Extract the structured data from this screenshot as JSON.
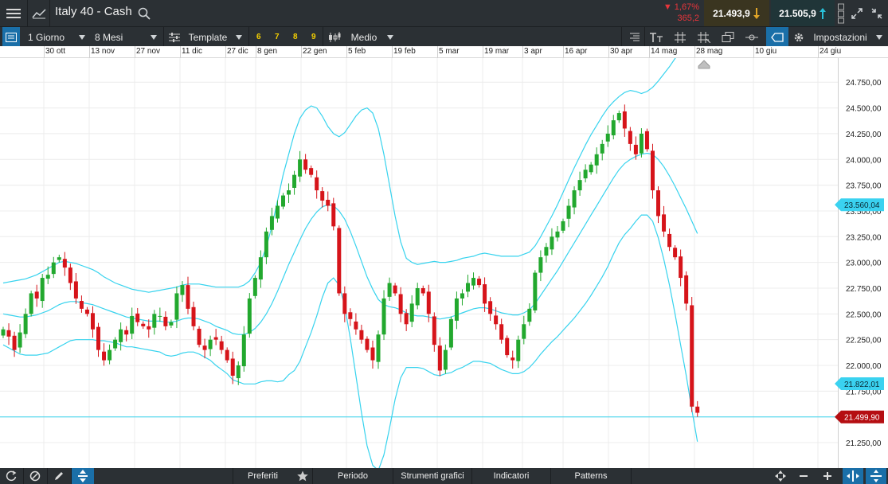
{
  "topbar": {
    "title": "Italy 40 - Cash",
    "change_pct": "▼ 1,67%",
    "change_pts": "365,2",
    "bid": "21.493,9",
    "ask": "21.505,9",
    "menu_icon": "menu-icon",
    "chart_icon": "chart-line-icon",
    "search_icon": "search-icon"
  },
  "toolbar": {
    "interval": "1 Giorno",
    "period": "8 Mesi",
    "template": "Template",
    "numbers": [
      "6",
      "7",
      "8",
      "9"
    ],
    "candle_type": "Medio",
    "settings": "Impostazioni"
  },
  "bottombar": {
    "favorites": "Preferiti",
    "period": "Periodo",
    "drawing_tools": "Strumenti grafici",
    "indicators": "Indicatori",
    "patterns": "Patterns"
  },
  "colors": {
    "up": "#22a82e",
    "down": "#d6141a",
    "bands": "#37d3ee",
    "price_tag": "#b50e12",
    "band_tag": "#3ad2f0"
  },
  "chart_data": {
    "type": "candlestick",
    "x_ticks": [
      "30 ott",
      "13 nov",
      "27 nov",
      "11 dic",
      "27 dic",
      "8 gen",
      "22 gen",
      "5 feb",
      "19 feb",
      "5 mar",
      "19 mar",
      "3 apr",
      "16 apr",
      "30 apr",
      "14 mag",
      "28 mag",
      "10 giu",
      "24 giu"
    ],
    "y_ticks": [
      "24.750,00",
      "24.500,00",
      "24.250,00",
      "24.000,00",
      "23.750,00",
      "23.500,00",
      "23.250,00",
      "23.000,00",
      "22.750,00",
      "22.500,00",
      "22.250,00",
      "22.000,00",
      "21.750,00",
      "21.500,00",
      "21.250,00"
    ],
    "y_tick_values": [
      24750,
      24500,
      24250,
      24000,
      23750,
      23500,
      23250,
      23000,
      22750,
      22500,
      22250,
      22000,
      21750,
      21500,
      21250
    ],
    "ylim": [
      21150,
      24860
    ],
    "indicator": "Bollinger Bands",
    "current_price": 21499.9,
    "current_price_label": "21.499,90",
    "band_upper_label": "23.560,04",
    "band_upper_value": 23560.04,
    "band_middle_label": "21.822,01",
    "band_middle_value": 21822.01,
    "closes": [
      22350,
      22280,
      22150,
      22320,
      22500,
      22700,
      22650,
      22850,
      22880,
      23000,
      23050,
      22950,
      22800,
      22650,
      22550,
      22500,
      22350,
      22150,
      22050,
      22150,
      22250,
      22350,
      22300,
      22480,
      22420,
      22380,
      22350,
      22500,
      22480,
      22380,
      22420,
      22700,
      22780,
      22550,
      22380,
      22200,
      22150,
      22250,
      22250,
      22150,
      22050,
      21900,
      22000,
      22300,
      22650,
      22850,
      23050,
      23300,
      23450,
      23550,
      23650,
      23700,
      23850,
      24000,
      23900,
      23850,
      23700,
      23600,
      23550,
      23350,
      22700,
      22500,
      22450,
      22350,
      22250,
      22150,
      22050,
      22300,
      22650,
      22800,
      22700,
      22500,
      22400,
      22600,
      22750,
      22700,
      22500,
      22200,
      21950,
      22150,
      22450,
      22650,
      22700,
      22800,
      22850,
      22780,
      22600,
      22500,
      22400,
      22250,
      22100,
      22050,
      22250,
      22400,
      22550,
      22900,
      23050,
      23150,
      23250,
      23300,
      23400,
      23550,
      23700,
      23800,
      23900,
      23950,
      24050,
      24150,
      24250,
      24380,
      24450,
      24300,
      24150,
      24050,
      24250,
      24100,
      23700,
      23450,
      23300,
      23150,
      23050,
      22850,
      22600,
      21600,
      21540
    ],
    "band_upper": [
      22800,
      22810,
      22820,
      22830,
      22840,
      22860,
      22880,
      22910,
      22940,
      22970,
      23000,
      23010,
      23000,
      22990,
      22970,
      22950,
      22930,
      22900,
      22860,
      22830,
      22800,
      22780,
      22760,
      22740,
      22730,
      22720,
      22710,
      22720,
      22730,
      22740,
      22750,
      22760,
      22780,
      22790,
      22790,
      22790,
      22780,
      22770,
      22760,
      22760,
      22760,
      22760,
      22760,
      22780,
      22820,
      22900,
      23000,
      23150,
      23350,
      23600,
      23850,
      24050,
      24250,
      24400,
      24480,
      24520,
      24500,
      24420,
      24320,
      24250,
      24220,
      24260,
      24340,
      24420,
      24480,
      24500,
      24450,
      24300,
      24050,
      23750,
      23450,
      23200,
      23040,
      23000,
      22980,
      22990,
      23000,
      23010,
      23000,
      23000,
      23010,
      23020,
      23040,
      23050,
      23060,
      23080,
      23090,
      23080,
      23070,
      23060,
      23060,
      23060,
      23060,
      23080,
      23100,
      23160,
      23250,
      23350,
      23450,
      23560,
      23680,
      23800,
      23920,
      24030,
      24140,
      24240,
      24330,
      24420,
      24500,
      24560,
      24610,
      24650,
      24670,
      24660,
      24640,
      24660,
      24700,
      24760,
      24830,
      24900,
      24980,
      25060,
      25140,
      25230,
      25300
    ],
    "band_middle": [
      22500,
      22490,
      22480,
      22470,
      22470,
      22480,
      22490,
      22510,
      22530,
      22560,
      22590,
      22610,
      22620,
      22620,
      22610,
      22600,
      22590,
      22570,
      22550,
      22530,
      22510,
      22490,
      22470,
      22460,
      22450,
      22440,
      22430,
      22430,
      22430,
      22420,
      22420,
      22430,
      22450,
      22460,
      22460,
      22450,
      22430,
      22410,
      22380,
      22360,
      22340,
      22310,
      22300,
      22300,
      22320,
      22360,
      22420,
      22500,
      22600,
      22720,
      22850,
      22980,
      23100,
      23220,
      23330,
      23420,
      23490,
      23540,
      23560,
      23550,
      23500,
      23420,
      23300,
      23160,
      23010,
      22860,
      22740,
      22640,
      22590,
      22570,
      22560,
      22540,
      22510,
      22490,
      22480,
      22480,
      22470,
      22460,
      22450,
      22460,
      22470,
      22490,
      22510,
      22530,
      22550,
      22560,
      22560,
      22550,
      22530,
      22510,
      22500,
      22490,
      22490,
      22510,
      22540,
      22600,
      22680,
      22760,
      22840,
      22920,
      23010,
      23100,
      23190,
      23280,
      23370,
      23460,
      23550,
      23640,
      23730,
      23820,
      23900,
      23960,
      24000,
      24030,
      24050,
      24060,
      24050,
      24000,
      23930,
      23840,
      23740,
      23630,
      23520,
      23400,
      23280
    ],
    "band_lower": [
      22200,
      22170,
      22140,
      22110,
      22100,
      22100,
      22100,
      22110,
      22120,
      22150,
      22180,
      22210,
      22240,
      22250,
      22250,
      22250,
      22250,
      22240,
      22240,
      22230,
      22220,
      22200,
      22180,
      22180,
      22170,
      22160,
      22150,
      22140,
      22130,
      22100,
      22090,
      22100,
      22120,
      22130,
      22130,
      22110,
      22080,
      22050,
      22000,
      21960,
      21920,
      21860,
      21840,
      21820,
      21820,
      21820,
      21840,
      21850,
      21850,
      21840,
      21850,
      21910,
      21950,
      22040,
      22180,
      22320,
      22480,
      22660,
      22800,
      22850,
      22780,
      22580,
      22260,
      21900,
      21540,
      21220,
      21030,
      20980,
      21130,
      21390,
      21670,
      21880,
      21980,
      21980,
      21980,
      21970,
      21940,
      21910,
      21900,
      21920,
      21930,
      21960,
      21980,
      22010,
      22040,
      22040,
      22030,
      22020,
      21990,
      21960,
      21940,
      21920,
      21920,
      21940,
      21980,
      22040,
      22110,
      22170,
      22230,
      22280,
      22340,
      22400,
      22460,
      22530,
      22600,
      22680,
      22770,
      22860,
      22960,
      23080,
      23190,
      23270,
      23330,
      23400,
      23460,
      23460,
      23400,
      23240,
      23030,
      22780,
      22500,
      22200,
      21900,
      21570,
      21260
    ]
  }
}
